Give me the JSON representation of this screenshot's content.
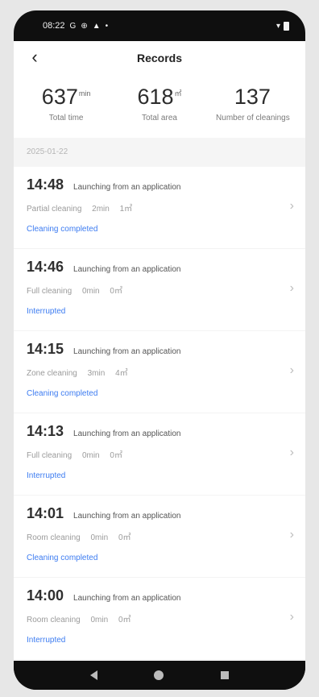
{
  "status": {
    "time": "08:22",
    "left_icons": [
      "google-icon",
      "settings-icon",
      "notification-icon",
      "dot-icon"
    ],
    "left_glyphs": [
      "G",
      "⊕",
      "▲",
      "•"
    ],
    "right_icons": [
      "wifi-icon",
      "battery-icon"
    ],
    "wifi_glyph": "▾"
  },
  "header": {
    "back_glyph": "‹",
    "title": "Records"
  },
  "stats": [
    {
      "value": "637",
      "unit": "min",
      "label": "Total time",
      "name": "total-time"
    },
    {
      "value": "618",
      "unit": "㎡",
      "label": "Total area",
      "name": "total-area"
    },
    {
      "value": "137",
      "unit": "",
      "label": "Number of cleanings",
      "name": "number-of-cleanings"
    }
  ],
  "date": "2025-01-22",
  "records": [
    {
      "time": "14:48",
      "source": "Launching from an application",
      "mode": "Partial cleaning",
      "duration": "2min",
      "area": "1㎡",
      "status": "Cleaning completed"
    },
    {
      "time": "14:46",
      "source": "Launching from an application",
      "mode": "Full cleaning",
      "duration": "0min",
      "area": "0㎡",
      "status": "Interrupted"
    },
    {
      "time": "14:15",
      "source": "Launching from an application",
      "mode": "Zone cleaning",
      "duration": "3min",
      "area": "4㎡",
      "status": "Cleaning completed"
    },
    {
      "time": "14:13",
      "source": "Launching from an application",
      "mode": "Full cleaning",
      "duration": "0min",
      "area": "0㎡",
      "status": "Interrupted"
    },
    {
      "time": "14:01",
      "source": "Launching from an application",
      "mode": "Room cleaning",
      "duration": "0min",
      "area": "0㎡",
      "status": "Cleaning completed"
    },
    {
      "time": "14:00",
      "source": "Launching from an application",
      "mode": "Room cleaning",
      "duration": "0min",
      "area": "0㎡",
      "status": "Interrupted"
    }
  ],
  "chevron_glyph": "›",
  "colors": {
    "status_link": "#3d7cf1",
    "background": "#ffffff",
    "frame": "#0f0f0f"
  }
}
